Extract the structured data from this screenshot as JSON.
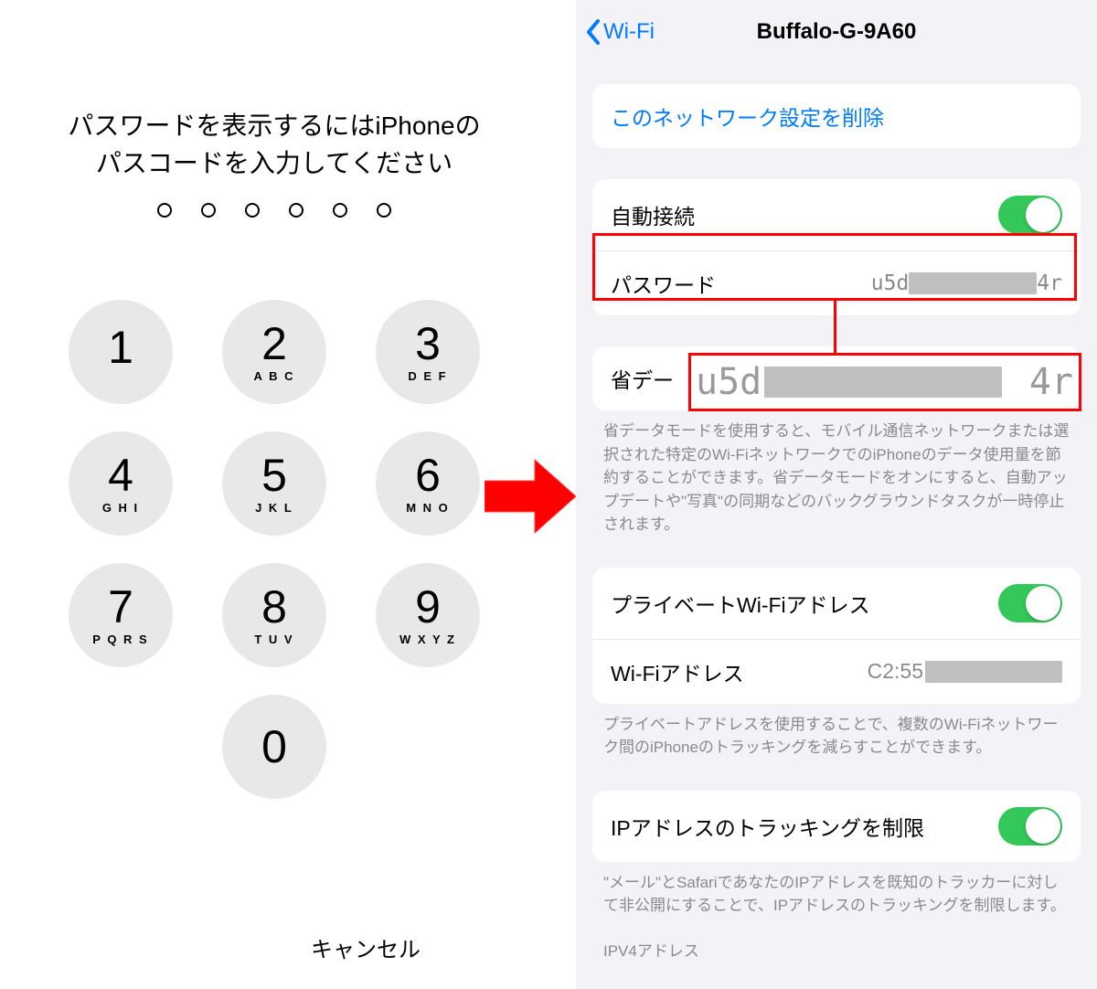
{
  "arrow_color": "#ff0000",
  "left_screen": {
    "prompt_line1": "パスワードを表示するにはiPhoneの",
    "prompt_line2": "パスコードを入力してください",
    "passcode_length": 6,
    "keys": [
      {
        "num": "1",
        "letters": ""
      },
      {
        "num": "2",
        "letters": "A B C"
      },
      {
        "num": "3",
        "letters": "D E F"
      },
      {
        "num": "4",
        "letters": "G H I"
      },
      {
        "num": "5",
        "letters": "J K L"
      },
      {
        "num": "6",
        "letters": "M N O"
      },
      {
        "num": "7",
        "letters": "P Q R S"
      },
      {
        "num": "8",
        "letters": "T U V"
      },
      {
        "num": "9",
        "letters": "W X Y Z"
      },
      {
        "num": "0",
        "letters": ""
      }
    ],
    "cancel_label": "キャンセル"
  },
  "right_screen": {
    "back_label": "Wi-Fi",
    "title": "Buffalo-G-9A60",
    "forget_label": "このネットワーク設定を削除",
    "auto_join_label": "自動接続",
    "auto_join_on": true,
    "password_label": "パスワード",
    "password_prefix": "u5d",
    "password_suffix": "4r",
    "low_data_label_truncated": "省デー",
    "low_data_footer": "省データモードを使用すると、モバイル通信ネットワークまたは選択された特定のWi-FiネットワークでのiPhoneのデータ使用量を節約することができます。省データモードをオンにすると、自動アップデートや\"写真\"の同期などのバックグラウンドタスクが一時停止されます。",
    "private_wifi_label": "プライベートWi-Fiアドレス",
    "private_wifi_on": true,
    "wifi_addr_label": "Wi-Fiアドレス",
    "wifi_addr_prefix": "C2:55",
    "private_footer": "プライベートアドレスを使用することで、複数のWi-Fiネットワーク間のiPhoneのトラッキングを減らすことができます。",
    "limit_ip_label": "IPアドレスのトラッキングを制限",
    "limit_ip_on": true,
    "limit_ip_footer": "\"メール\"とSafariであなたのIPアドレスを既知のトラッカーに対して非公開にすることで、IPアドレスのトラッキングを制限します。",
    "ipv4_section": "IPV4アドレス"
  },
  "enlarged_password": {
    "prefix": "u5d",
    "suffix": "4r"
  }
}
